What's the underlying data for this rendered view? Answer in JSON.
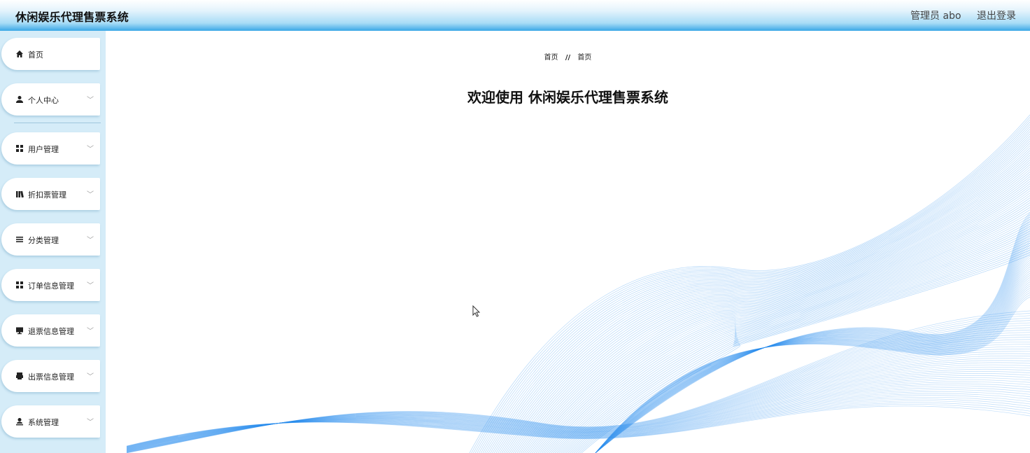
{
  "header": {
    "title": "休闲娱乐代理售票系统",
    "user_label": "管理员 abo",
    "logout_label": "退出登录"
  },
  "sidebar": {
    "items": [
      {
        "label": "首页",
        "icon": "home-icon"
      },
      {
        "label": "个人中心",
        "icon": "person-icon"
      },
      {
        "label": "用户管理",
        "icon": "grid-icon"
      },
      {
        "label": "折扣票管理",
        "icon": "books-icon"
      },
      {
        "label": "分类管理",
        "icon": "list-icon"
      },
      {
        "label": "订单信息管理",
        "icon": "grid-icon"
      },
      {
        "label": "退票信息管理",
        "icon": "monitor-icon"
      },
      {
        "label": "出票信息管理",
        "icon": "printer-icon"
      },
      {
        "label": "系统管理",
        "icon": "user-settings-icon"
      }
    ],
    "caret": "﹀"
  },
  "main": {
    "breadcrumb": [
      "首页",
      "首页"
    ],
    "breadcrumb_sep": "//",
    "welcome": "欢迎使用 休闲娱乐代理售票系统"
  },
  "colors": {
    "header_gradient_bottom": "#3aa8e6",
    "sidebar_bg": "#d5ecf8",
    "wave_blue": "#2b8fef"
  }
}
